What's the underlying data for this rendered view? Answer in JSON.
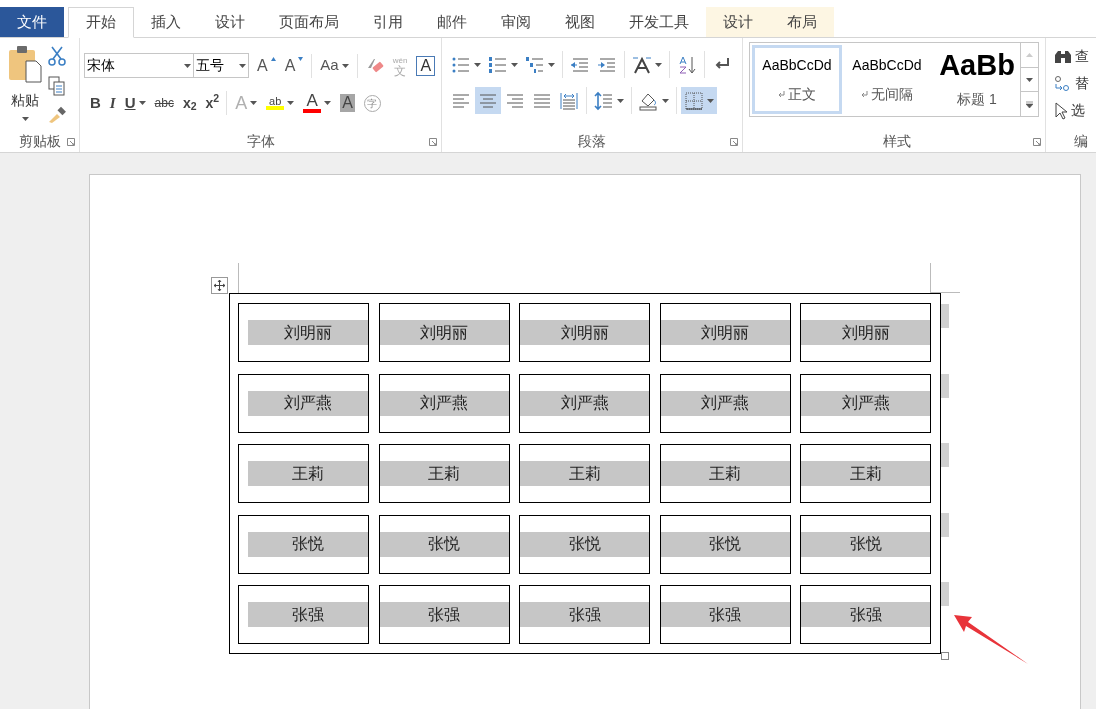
{
  "tabs": [
    {
      "label": "文件",
      "kind": "file",
      "selected": false
    },
    {
      "label": "开始",
      "kind": "normal",
      "selected": true
    },
    {
      "label": "插入",
      "kind": "normal",
      "selected": false
    },
    {
      "label": "设计",
      "kind": "normal",
      "selected": false
    },
    {
      "label": "页面布局",
      "kind": "normal",
      "selected": false
    },
    {
      "label": "引用",
      "kind": "normal",
      "selected": false
    },
    {
      "label": "邮件",
      "kind": "normal",
      "selected": false
    },
    {
      "label": "审阅",
      "kind": "normal",
      "selected": false
    },
    {
      "label": "视图",
      "kind": "normal",
      "selected": false
    },
    {
      "label": "开发工具",
      "kind": "normal",
      "selected": false
    },
    {
      "label": "设计",
      "kind": "contextual",
      "selected": false
    },
    {
      "label": "布局",
      "kind": "contextual",
      "selected": false
    }
  ],
  "ribbon": {
    "clipboard": {
      "paste_label": "粘贴",
      "group_label": "剪贴板"
    },
    "font": {
      "font_name": "宋体",
      "font_size": "五号",
      "group_label": "字体",
      "row1": [
        [
          {
            "kind": "grow",
            "label": "A"
          },
          {
            "kind": "shrink",
            "label": "A"
          }
        ],
        [
          {
            "kind": "case",
            "label": "Aa",
            "dropdown": true
          }
        ],
        [
          {
            "kind": "clear"
          },
          {
            "kind": "phonetic",
            "ruby": "wén",
            "label": "文"
          },
          {
            "kind": "boxed",
            "label": "A"
          }
        ]
      ],
      "row2": [
        [
          {
            "kind": "bold",
            "label": "B"
          },
          {
            "kind": "italic",
            "label": "I"
          },
          {
            "kind": "underline",
            "label": "U",
            "dropdown": true
          },
          {
            "kind": "strike",
            "label": "abc"
          },
          {
            "kind": "script",
            "label": "x$_{2}$"
          },
          {
            "kind": "script",
            "label": "x$^{2}$"
          }
        ],
        [
          {
            "kind": "effects",
            "label": "A",
            "dropdown": true
          },
          {
            "kind": "highlight",
            "label": "ab",
            "dropdown": true,
            "color": "#ffff00"
          },
          {
            "kind": "fontcolor",
            "label": "A",
            "dropdown": true,
            "color": "#ff0000"
          },
          {
            "kind": "shading",
            "label": "A"
          },
          {
            "kind": "enclose",
            "label": "字"
          }
        ]
      ]
    },
    "paragraph": {
      "group_label": "段落",
      "row1": [
        [
          {
            "kind": "bullets",
            "dropdown": true,
            "selected": false
          },
          {
            "kind": "numbering",
            "dropdown": true,
            "selected": false
          },
          {
            "kind": "multilevel",
            "dropdown": true,
            "selected": false
          }
        ],
        [
          {
            "kind": "outdent",
            "dropdown": false,
            "selected": false
          },
          {
            "kind": "indent",
            "dropdown": false,
            "selected": false
          }
        ],
        [
          {
            "kind": "asian",
            "dropdown": true,
            "selected": false
          }
        ],
        [
          {
            "kind": "sort",
            "dropdown": false,
            "selected": false
          }
        ],
        [
          {
            "kind": "marks",
            "dropdown": false,
            "selected": false
          }
        ]
      ],
      "row2": [
        [
          {
            "kind": "left",
            "dropdown": false,
            "selected": false
          },
          {
            "kind": "center",
            "dropdown": false,
            "selected": true
          },
          {
            "kind": "right",
            "dropdown": false,
            "selected": false
          },
          {
            "kind": "justify",
            "dropdown": false,
            "selected": false
          },
          {
            "kind": "distribute",
            "dropdown": false,
            "selected": false
          }
        ],
        [
          {
            "kind": "spacing",
            "dropdown": true,
            "selected": false
          }
        ],
        [
          {
            "kind": "fill",
            "dropdown": true,
            "selected": false
          }
        ],
        [
          {
            "kind": "borders",
            "dropdown": true,
            "selected": true
          }
        ]
      ]
    },
    "styles": {
      "group_label": "样式",
      "items": [
        {
          "kind": "normal",
          "preview": "AaBbCcDd",
          "label": "正文",
          "para_mark": true,
          "selected": true
        },
        {
          "kind": "normal",
          "preview": "AaBbCcDd",
          "label": "无间隔",
          "para_mark": true,
          "selected": false
        },
        {
          "kind": "heading",
          "preview": "AaBb",
          "label": "标题 1",
          "para_mark": false,
          "selected": false
        }
      ]
    },
    "editing": {
      "group_label": "编",
      "items": [
        {
          "kind": "find",
          "label": "查"
        },
        {
          "kind": "replace",
          "label": "替"
        },
        {
          "kind": "select",
          "label": "选"
        }
      ]
    }
  },
  "table": {
    "rows": [
      [
        "刘明丽",
        "刘明丽",
        "刘明丽",
        "刘明丽",
        "刘明丽"
      ],
      [
        "刘严燕",
        "刘严燕",
        "刘严燕",
        "刘严燕",
        "刘严燕"
      ],
      [
        "王莉",
        "王莉",
        "王莉",
        "王莉",
        "王莉"
      ],
      [
        "张悦",
        "张悦",
        "张悦",
        "张悦",
        "张悦"
      ],
      [
        "张强",
        "张强",
        "张强",
        "张强",
        "张强"
      ]
    ]
  }
}
